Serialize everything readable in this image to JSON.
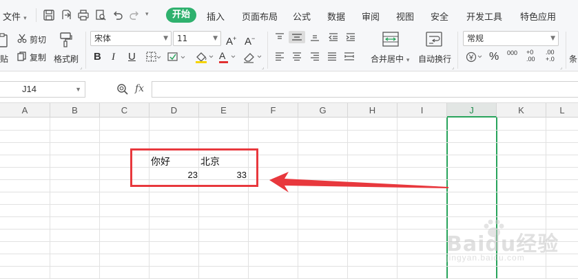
{
  "menubar": {
    "file_label": "文件",
    "tabs": [
      "开始",
      "插入",
      "页面布局",
      "公式",
      "数据",
      "审阅",
      "视图",
      "安全",
      "开发工具",
      "特色应用"
    ],
    "active_tab_color": "#2fb16e"
  },
  "ribbon": {
    "paste_label": "贴",
    "cut_label": "剪切",
    "copy_label": "复制",
    "format_painter_label": "格式刷",
    "font_name": "宋体",
    "font_size": "11",
    "bold_label": "B",
    "italic_label": "I",
    "underline_label": "U",
    "font_color_label": "A",
    "merge_center_label": "合并居中",
    "wrap_text_label": "自动换行",
    "number_format": "常规",
    "percent_label": "%",
    "thousands_label": "000",
    "dec_increase_label": "+0 .00",
    "dec_decrease_label": ".00 +.0",
    "cond_label": "条",
    "font_color_hex": "#e03030",
    "fill_color_hex": "#f5d400"
  },
  "formula_bar": {
    "name_box": "J14",
    "fx_label": "fx",
    "formula_value": ""
  },
  "columns": [
    "A",
    "B",
    "C",
    "D",
    "E",
    "F",
    "G",
    "H",
    "I",
    "J",
    "K",
    "L"
  ],
  "selected_column": "J",
  "cells": {
    "D1": "你好",
    "E1": "北京",
    "D2": "23",
    "E2": "33"
  },
  "annotation_color": "#e8383d",
  "watermark": {
    "brand": "Baidu经验",
    "url": "jingyan.baidu.com"
  }
}
